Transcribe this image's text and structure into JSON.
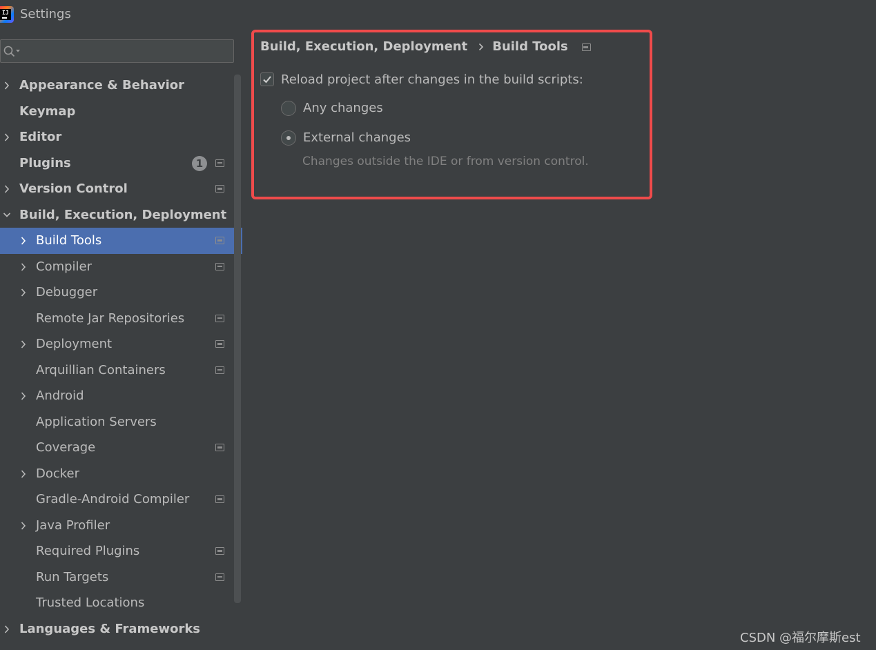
{
  "window": {
    "title": "Settings"
  },
  "search": {
    "value": "",
    "placeholder": ""
  },
  "sidebar": {
    "items": [
      {
        "label": "Appearance & Behavior",
        "level": 0,
        "bold": true,
        "chevron": "right",
        "project_icon": false
      },
      {
        "label": "Keymap",
        "level": 0,
        "bold": true,
        "chevron": "none",
        "project_icon": false
      },
      {
        "label": "Editor",
        "level": 0,
        "bold": true,
        "chevron": "right",
        "project_icon": false
      },
      {
        "label": "Plugins",
        "level": 0,
        "bold": true,
        "chevron": "none",
        "project_icon": true,
        "badge": "1"
      },
      {
        "label": "Version Control",
        "level": 0,
        "bold": true,
        "chevron": "right",
        "project_icon": true
      },
      {
        "label": "Build, Execution, Deployment",
        "level": 0,
        "bold": true,
        "chevron": "down",
        "project_icon": false
      },
      {
        "label": "Build Tools",
        "level": 1,
        "bold": false,
        "chevron": "right",
        "project_icon": true,
        "selected": true
      },
      {
        "label": "Compiler",
        "level": 1,
        "bold": false,
        "chevron": "right",
        "project_icon": true
      },
      {
        "label": "Debugger",
        "level": 1,
        "bold": false,
        "chevron": "right",
        "project_icon": false
      },
      {
        "label": "Remote Jar Repositories",
        "level": 1,
        "bold": false,
        "chevron": "none",
        "project_icon": true
      },
      {
        "label": "Deployment",
        "level": 1,
        "bold": false,
        "chevron": "right",
        "project_icon": true
      },
      {
        "label": "Arquillian Containers",
        "level": 1,
        "bold": false,
        "chevron": "none",
        "project_icon": true
      },
      {
        "label": "Android",
        "level": 1,
        "bold": false,
        "chevron": "right",
        "project_icon": false
      },
      {
        "label": "Application Servers",
        "level": 1,
        "bold": false,
        "chevron": "none",
        "project_icon": false
      },
      {
        "label": "Coverage",
        "level": 1,
        "bold": false,
        "chevron": "none",
        "project_icon": true
      },
      {
        "label": "Docker",
        "level": 1,
        "bold": false,
        "chevron": "right",
        "project_icon": false
      },
      {
        "label": "Gradle-Android Compiler",
        "level": 1,
        "bold": false,
        "chevron": "none",
        "project_icon": true
      },
      {
        "label": "Java Profiler",
        "level": 1,
        "bold": false,
        "chevron": "right",
        "project_icon": false
      },
      {
        "label": "Required Plugins",
        "level": 1,
        "bold": false,
        "chevron": "none",
        "project_icon": true
      },
      {
        "label": "Run Targets",
        "level": 1,
        "bold": false,
        "chevron": "none",
        "project_icon": true
      },
      {
        "label": "Trusted Locations",
        "level": 1,
        "bold": false,
        "chevron": "none",
        "project_icon": false
      },
      {
        "label": "Languages & Frameworks",
        "level": 0,
        "bold": true,
        "chevron": "right",
        "project_icon": false
      }
    ]
  },
  "content": {
    "breadcrumb": {
      "parent": "Build, Execution, Deployment",
      "current": "Build Tools"
    },
    "reload_checkbox": {
      "label": "Reload project after changes in the build scripts:",
      "checked": true
    },
    "options": [
      {
        "label": "Any changes",
        "selected": false
      },
      {
        "label": "External changes",
        "selected": true
      }
    ],
    "hint": "Changes outside the IDE or from version control."
  },
  "colors": {
    "background": "#3c3f41",
    "selection": "#4b6eaf",
    "highlight_border": "#ef4b4b",
    "text": "#bbbbbb",
    "hint_text": "#808080"
  },
  "watermark": "CSDN @福尔摩斯est"
}
